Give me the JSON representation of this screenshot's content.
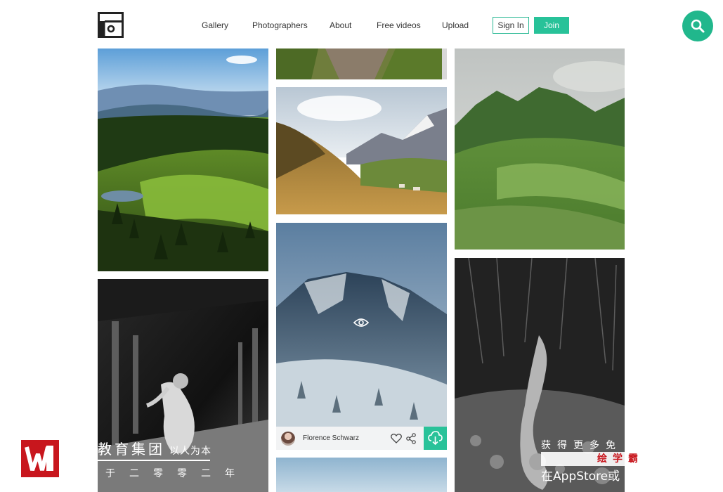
{
  "brand": {
    "logo_icon": "unsplash-style-frame-logo"
  },
  "nav": {
    "items": [
      {
        "label": "Gallery"
      },
      {
        "label": "Photographers"
      },
      {
        "label": "About"
      },
      {
        "label": "Free videos"
      },
      {
        "label": "Upload"
      }
    ],
    "sign_in": "Sign In",
    "join": "Join",
    "search_icon": "search-icon",
    "accent": "#21b78c"
  },
  "gallery": {
    "photos": [
      {
        "subject": "forest-valley-lake"
      },
      {
        "subject": "rocky-trail"
      },
      {
        "subject": "alpine-pasture"
      },
      {
        "subject": "misty-green-ridge"
      },
      {
        "subject": "bw-train-station-dancer"
      },
      {
        "subject": "snowy-forest-mountain"
      },
      {
        "subject": "bw-reclining-figure"
      },
      {
        "subject": "sky-partial"
      }
    ],
    "hover_card": {
      "author": "Florence Schwarz",
      "icons": [
        "eye-icon",
        "heart-icon",
        "share-icon",
        "download-icon"
      ]
    }
  },
  "watermark": {
    "title": "教育集团",
    "slogan": "以人为本",
    "sub": "于二零零二年",
    "right_line1": "获得更多免",
    "right_brand": "绘学霸",
    "right_line3": "在AppStore或"
  }
}
